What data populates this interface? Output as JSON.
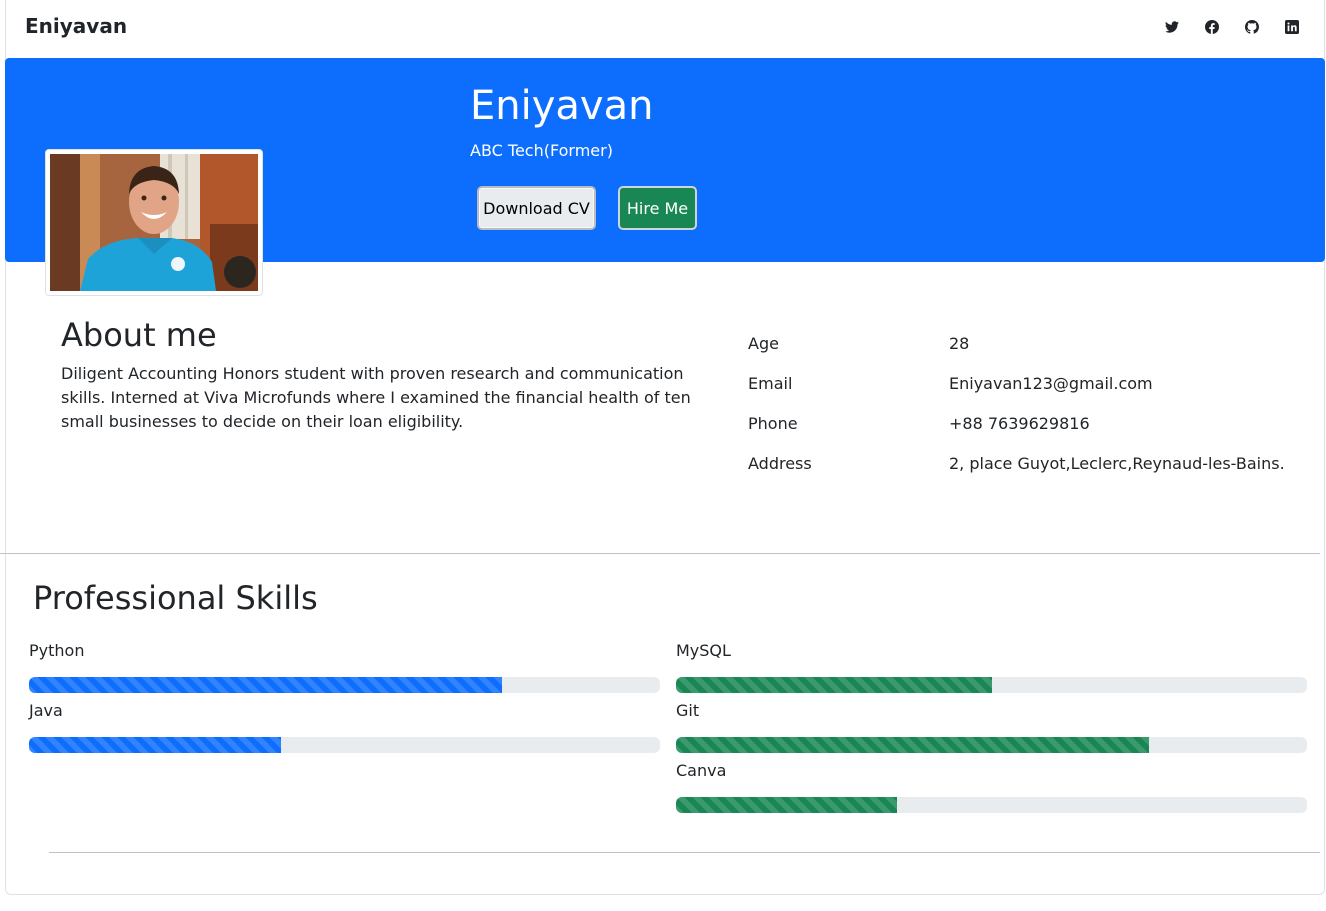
{
  "navbar": {
    "brand": "Eniyavan",
    "social": [
      {
        "icon": "twitter-icon"
      },
      {
        "icon": "facebook-icon"
      },
      {
        "icon": "github-icon"
      },
      {
        "icon": "linkedin-icon"
      }
    ]
  },
  "hero": {
    "name": "Eniyavan",
    "subtitle": "ABC Tech(Former)",
    "download_label": "Download CV",
    "hire_label": "Hire Me",
    "background_color": "#0d6efd"
  },
  "about": {
    "title": "About me",
    "text": "Diligent Accounting Honors student with proven research and communication skills. Interned at Viva Microfunds where I examined the financial health of ten small businesses to decide on their loan eligibility."
  },
  "info": [
    {
      "label": "Age",
      "value": "28"
    },
    {
      "label": "Email",
      "value": "Eniyavan123@gmail.com"
    },
    {
      "label": "Phone",
      "value": "+88 7639629816"
    },
    {
      "label": "Address",
      "value": "2, place Guyot,Leclerc,Reynaud-les-Bains."
    }
  ],
  "skills": {
    "title": "Professional Skills",
    "left": [
      {
        "name": "Python",
        "level": 0.75,
        "color": "#0d6efd"
      },
      {
        "name": "Java",
        "level": 0.4,
        "color": "#0d6efd"
      }
    ],
    "right": [
      {
        "name": "MySQL",
        "level": 0.5,
        "color": "#198754"
      },
      {
        "name": "Git",
        "level": 0.75,
        "color": "#198754"
      },
      {
        "name": "Canva",
        "level": 0.35,
        "color": "#198754"
      }
    ]
  }
}
